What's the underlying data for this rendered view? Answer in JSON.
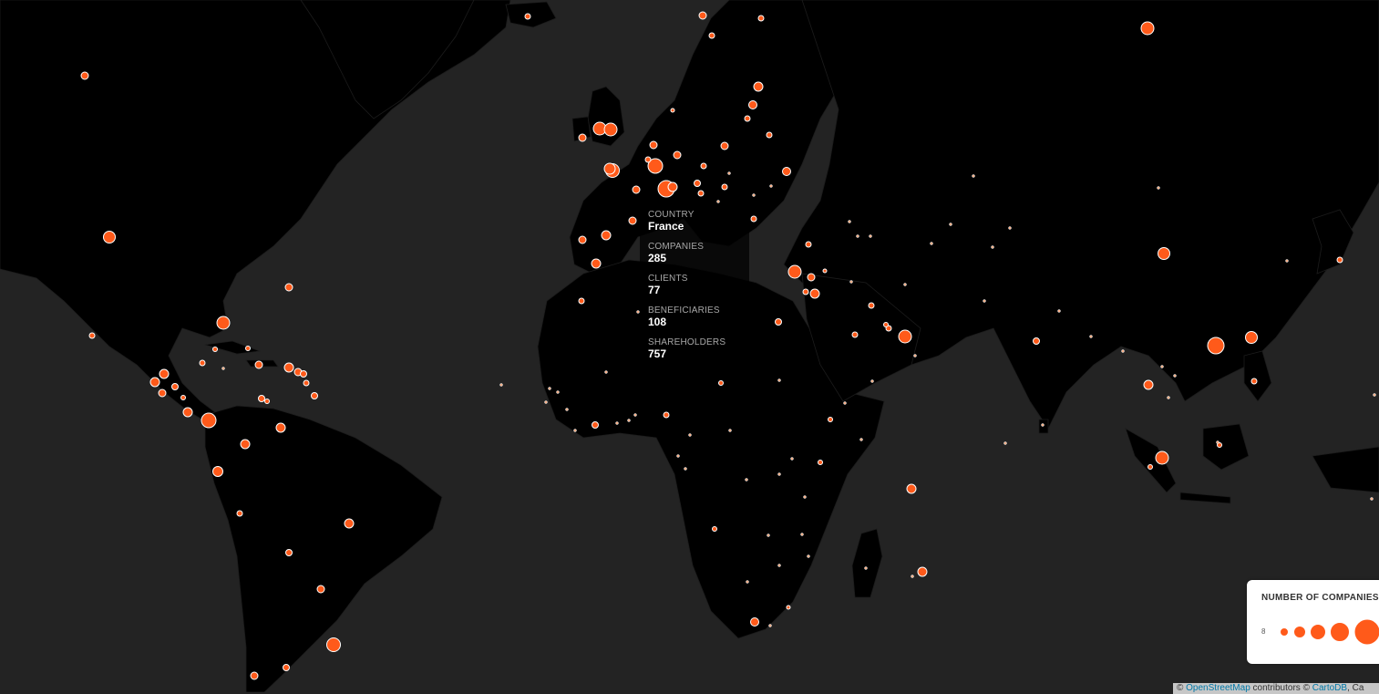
{
  "map": {
    "ocean_color": "#232323",
    "land_color": "#000000",
    "bubble_color": "#ff5a1a",
    "bubble_stroke": "#ffffff"
  },
  "tooltip": {
    "country_label": "COUNTRY",
    "country_value": "France",
    "companies_label": "COMPANIES",
    "companies_value": "285",
    "clients_label": "CLIENTS",
    "clients_value": "77",
    "beneficiaries_label": "BENEFICIARIES",
    "beneficiaries_value": "108",
    "shareholders_label": "SHAREHOLDERS",
    "shareholders_value": "757"
  },
  "legend": {
    "title": "NUMBER OF COMPANIES",
    "min_label": "8"
  },
  "attribution": {
    "prefix": "© ",
    "osm_link": "OpenStreetMap",
    "middle": " contributors © ",
    "carto_link": "CartoDB",
    "suffix": ", Ca"
  }
}
